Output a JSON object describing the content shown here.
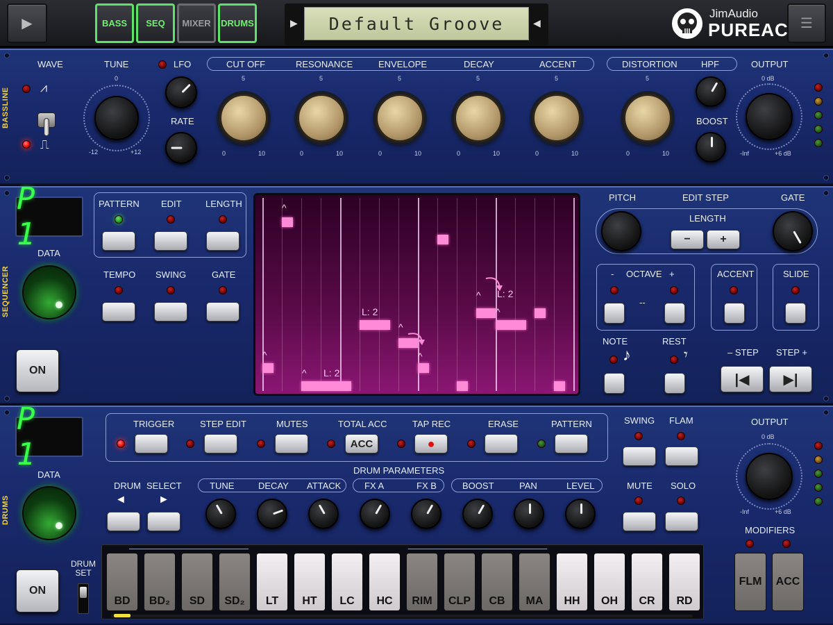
{
  "app": {
    "logo_line1": "JimAudio",
    "logo_line2": "PUREACID"
  },
  "topbar": {
    "tabs": [
      {
        "label": "BASS",
        "active": true
      },
      {
        "label": "SEQ",
        "active": true
      },
      {
        "label": "MIXER",
        "active": false
      },
      {
        "label": "DRUMS",
        "active": true
      }
    ],
    "preset_name": "Default Groove",
    "prev_glyph": "◀",
    "next_glyph": "◀",
    "play_glyph": "▶",
    "menu_glyph": "☰"
  },
  "bassline": {
    "section_label": "BASSLINE",
    "wave_label": "WAVE",
    "saw_glyph": "⩘",
    "square_glyph": "⎍",
    "tune_label": "TUNE",
    "tune_center": "0",
    "tune_min": "-12",
    "tune_max": "+12",
    "lfo_label": "LFO",
    "rate_label": "RATE",
    "filter_group": [
      "CUT OFF",
      "RESONANCE",
      "ENVELOPE",
      "DECAY",
      "ACCENT"
    ],
    "dist_group": [
      "DISTORTION",
      "HPF"
    ],
    "boost_label": "BOOST",
    "output_label": "OUTPUT",
    "output_top": "0 dB",
    "output_min": "-Inf",
    "output_max": "+6 dB",
    "knob_scale": {
      "mid": "5",
      "min": "0",
      "max": "10"
    }
  },
  "sequencer": {
    "section_label": "SEQUENCER",
    "display_value": "P 1",
    "data_label": "DATA",
    "on_label": "ON",
    "buttons_row1": [
      "PATTERN",
      "EDIT",
      "LENGTH"
    ],
    "buttons_row2": [
      "TEMPO",
      "SWING",
      "GATE"
    ],
    "note_labels": [
      "L: 2",
      "L: 2",
      "L: 2"
    ],
    "accent_glyph": "^",
    "pitch_label": "PITCH",
    "edit_step_label": "EDIT  STEP",
    "gate_label": "GATE",
    "length_label": "LENGTH",
    "minus": "−",
    "plus": "+",
    "octave_label": "OCTAVE",
    "octave_minus": "-",
    "octave_plus": "+",
    "octave_value": "--",
    "accent_label": "ACCENT",
    "slide_label": "SLIDE",
    "note_label": "NOTE",
    "rest_label": "REST",
    "note_glyph": "♪",
    "rest_glyph": "𝄾",
    "step_minus": "– STEP",
    "step_plus": "STEP +",
    "step_prev_glyph": "|◀",
    "step_next_glyph": "▶|"
  },
  "drums": {
    "section_label": "DRUMS",
    "display_value": "P 1",
    "data_label": "DATA",
    "on_label": "ON",
    "modes": [
      "TRIGGER",
      "STEP EDIT",
      "MUTES",
      "TOTAL ACC",
      "TAP REC",
      "ERASE",
      "PATTERN"
    ],
    "acc_label": "ACC",
    "rec_glyph": "●",
    "drum_params_label": "DRUM  PARAMETERS",
    "drum_select": [
      "DRUM",
      "SELECT"
    ],
    "select_left": "◄",
    "select_right": "►",
    "param_group1": [
      "TUNE",
      "DECAY",
      "ATTACK"
    ],
    "param_group2": [
      "FX A",
      "FX B"
    ],
    "param_group3": [
      "BOOST",
      "PAN",
      "LEVEL"
    ],
    "swing_label": "SWING",
    "flam_label": "FLAM",
    "mute_label": "MUTE",
    "solo_label": "SOLO",
    "output_label": "OUTPUT",
    "output_top": "0 dB",
    "output_min": "-Inf",
    "output_max": "+6 dB",
    "modifiers_label": "MODIFIERS",
    "flm_label": "FLM",
    "modifier_acc_label": "ACC",
    "drum_set_label": "DRUM SET",
    "pads": [
      "BD",
      "BD₂",
      "SD",
      "SD₂",
      "LT",
      "HT",
      "LC",
      "HC",
      "RIM",
      "CLP",
      "CB",
      "MA",
      "HH",
      "OH",
      "CR",
      "RD"
    ]
  },
  "colors": {
    "accent_green": "#5ee26a",
    "led_red": "#ff1a1a",
    "panel_blue": "#1a2a6c",
    "grid_pink": "#ff8ad8",
    "lcd": "#cdd4a8"
  }
}
